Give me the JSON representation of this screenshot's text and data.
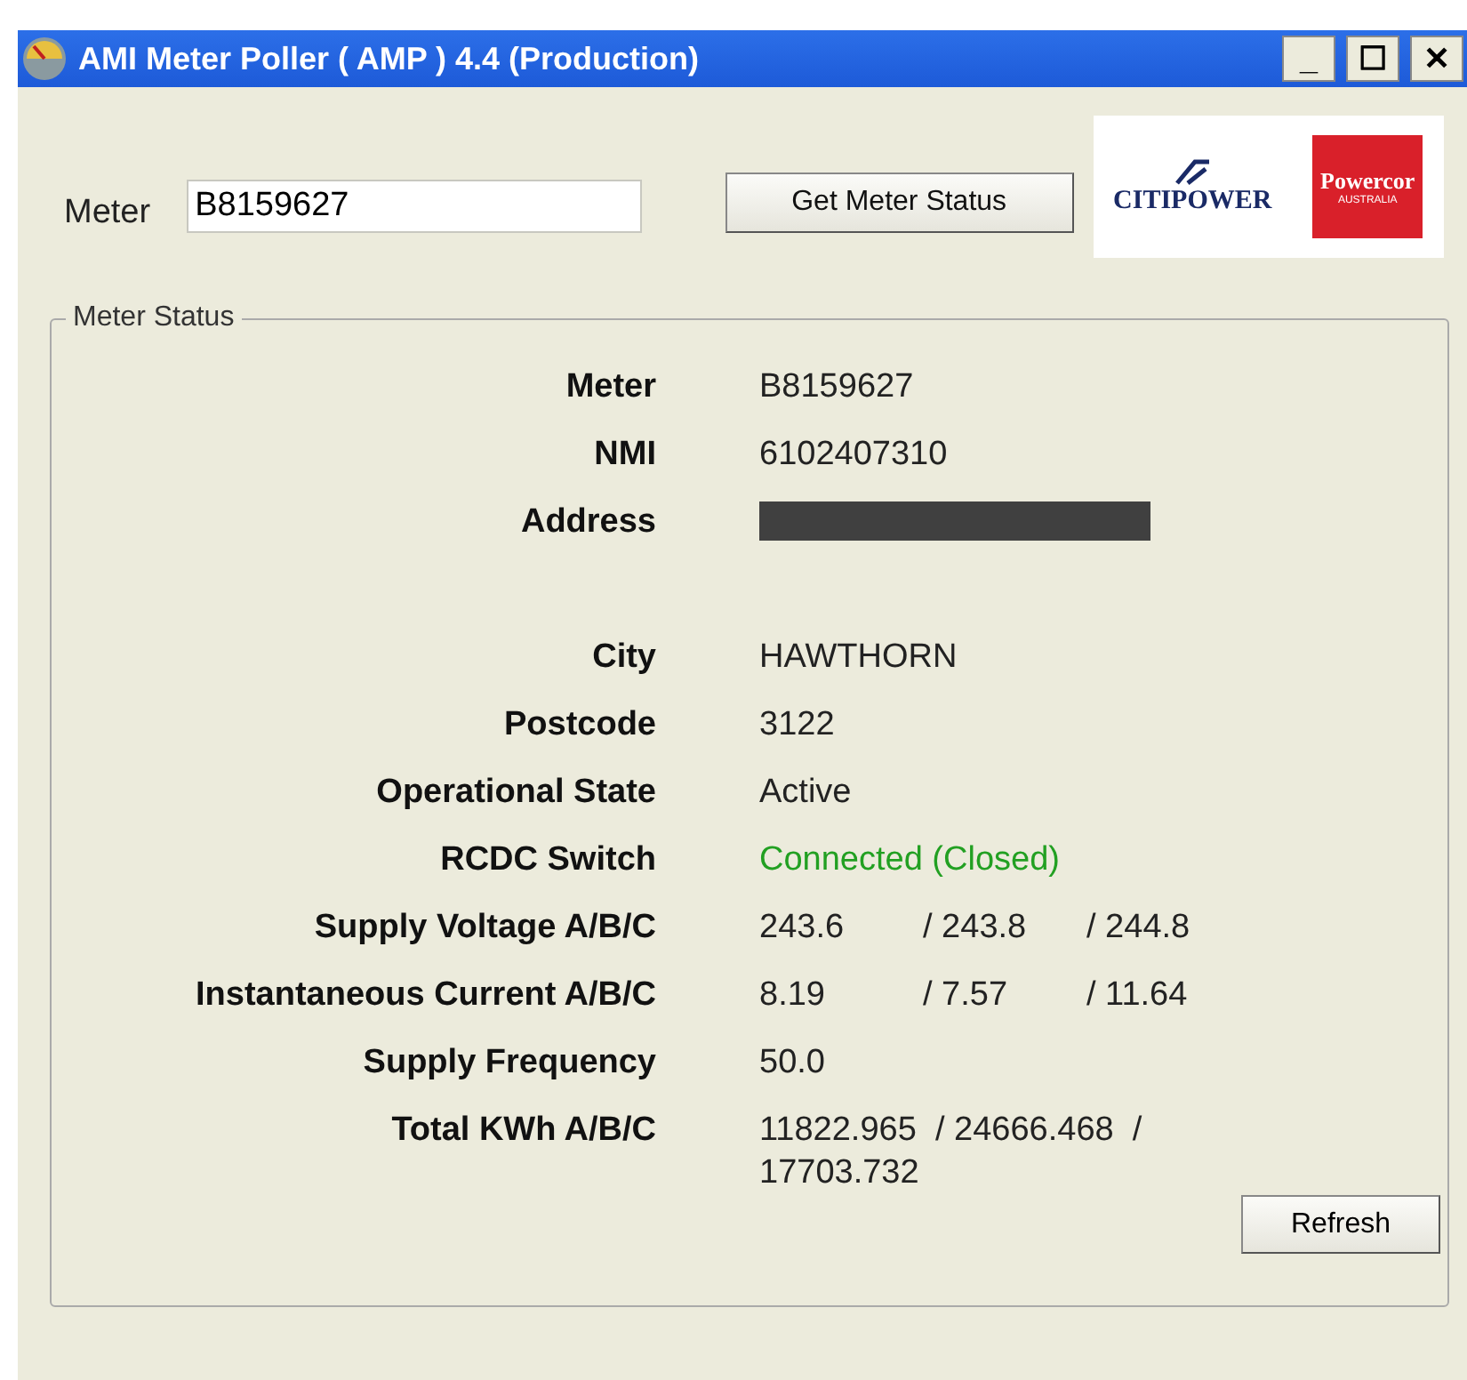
{
  "window": {
    "title": "AMI Meter Poller ( AMP ) 4.4 (Production)",
    "controls": [
      "_",
      "☐",
      "✕"
    ]
  },
  "meter_field": {
    "label": "Meter",
    "value": "B8159627"
  },
  "get_status_button": "Get Meter Status",
  "logos": [
    {
      "kind": "citipower",
      "text": "CITIPOWER"
    },
    {
      "kind": "powercor",
      "text": "Powercor",
      "sub": "AUSTRALIA"
    }
  ],
  "meter_status": {
    "title": "Meter Status",
    "rows": [
      {
        "label": "Meter",
        "values": [
          "B8159627"
        ]
      },
      {
        "label": "NMI",
        "values": [
          "6102407310"
        ]
      },
      {
        "label": "Address",
        "redacted": true,
        "values": []
      },
      {
        "label": "City",
        "values": [
          "HAWTHORN"
        ]
      },
      {
        "label": "Postcode",
        "values": [
          "3122"
        ]
      },
      {
        "label": "Operational State",
        "values": [
          "Active"
        ]
      },
      {
        "label": "RCDC Switch",
        "values": [
          "Connected (Closed)"
        ],
        "color": "#22a022"
      },
      {
        "label": "Supply Voltage A/B/C",
        "values": [
          "243.6",
          "/ 243.8",
          "/ 244.8"
        ]
      },
      {
        "label": "Instantaneous Current A/B/C",
        "values": [
          "8.19",
          "/ 7.57",
          "/ 11.64"
        ]
      },
      {
        "label": "Supply Frequency",
        "values": [
          "50.0"
        ]
      },
      {
        "label": "Total KWh A/B/C",
        "values": [
          "11822.965  / 24666.468  / 17703.732"
        ]
      }
    ],
    "refresh_button": "Refresh"
  }
}
